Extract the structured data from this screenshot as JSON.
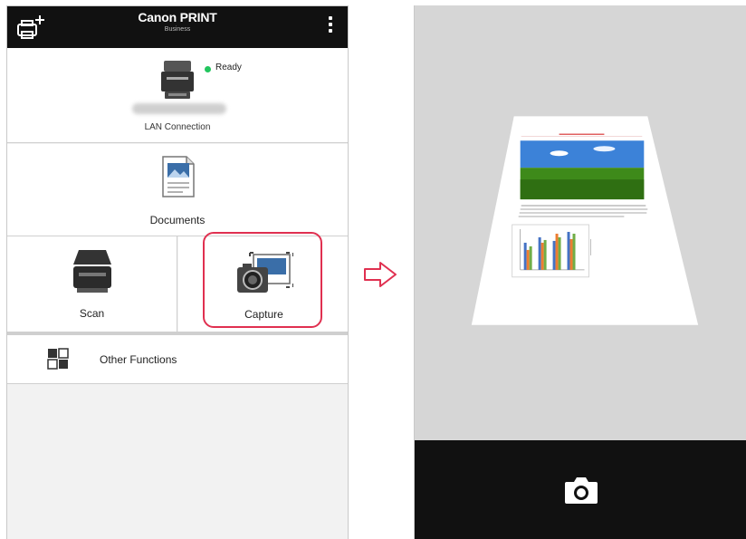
{
  "left_screen": {
    "header": {
      "title": "Canon PRINT",
      "subtitle": "Business",
      "add_printer_icon": "printer-plus-icon",
      "menu_icon": "kebab-menu-icon"
    },
    "printer": {
      "status": "Ready",
      "status_color": "#22c55e",
      "connection": "LAN Connection"
    },
    "tiles": {
      "documents": "Documents",
      "scan": "Scan",
      "capture": "Capture",
      "other_functions": "Other Functions"
    },
    "highlight_color": "#e03050"
  },
  "arrow_icon": "right-outline-arrow-icon",
  "right_screen": {
    "shutter_icon": "camera-icon"
  }
}
